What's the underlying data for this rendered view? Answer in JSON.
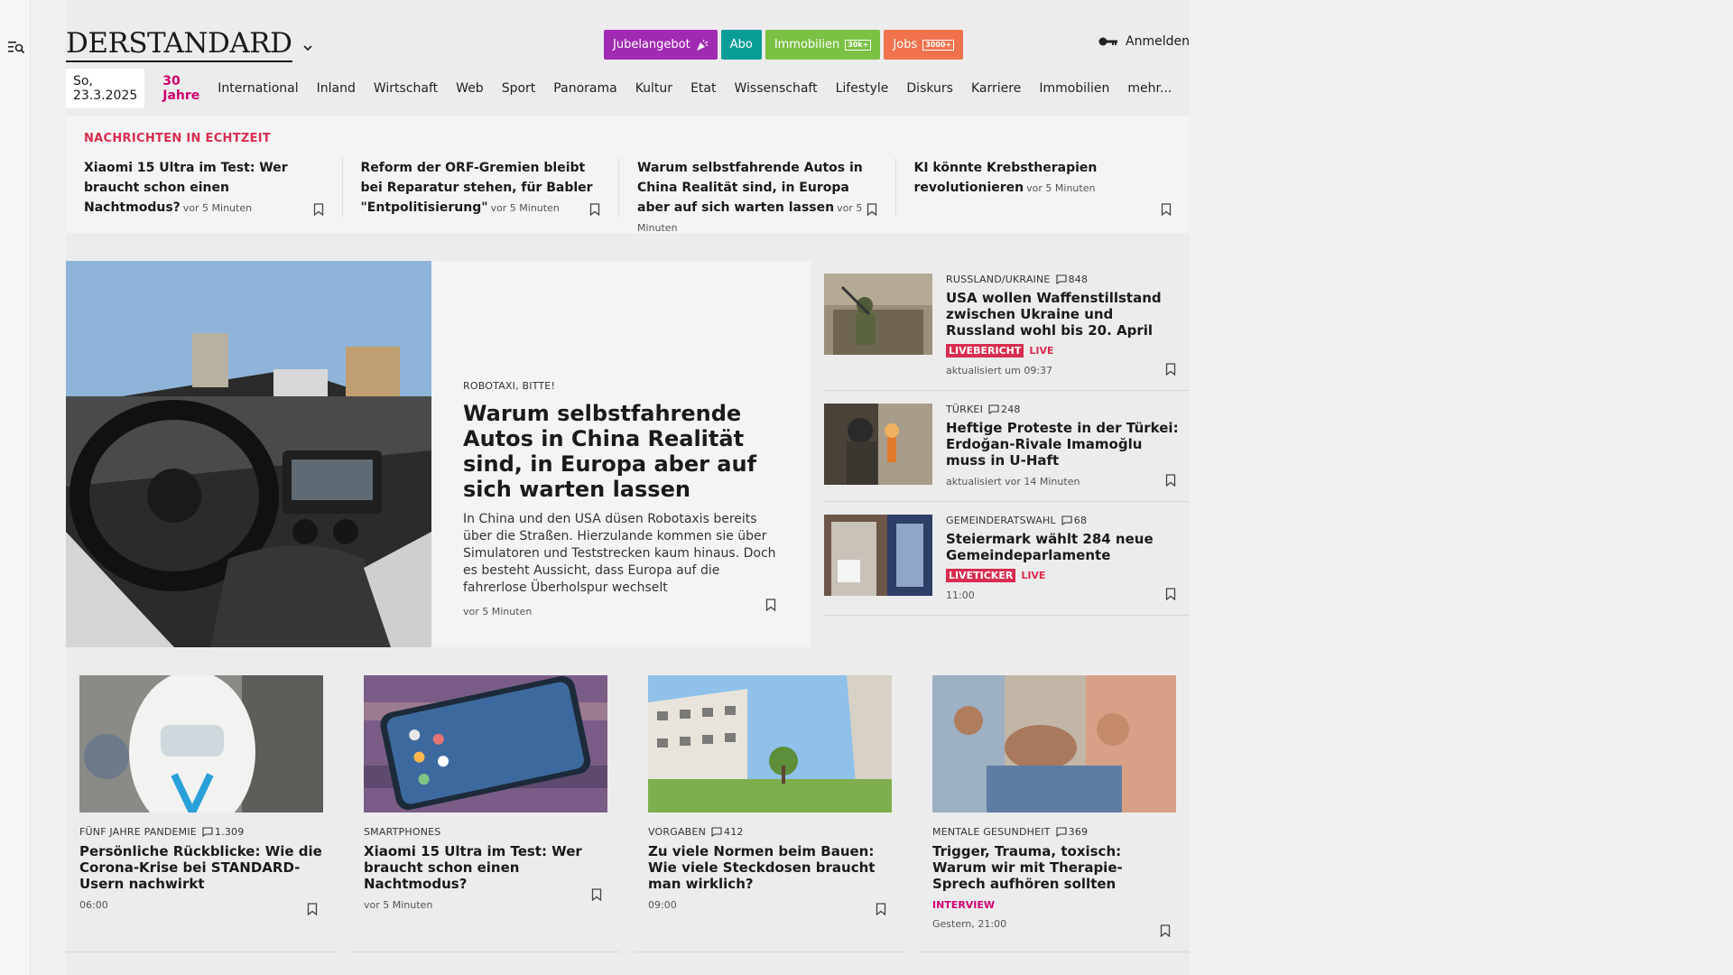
{
  "brand": {
    "logo": "DERSTANDARD"
  },
  "promo": [
    {
      "label": "Jubelangebot",
      "color": "#a12ab3"
    },
    {
      "label": "Abo",
      "color": "#0a9d98"
    },
    {
      "label": "Immobilien",
      "tag": "30k+",
      "color": "#7bc144"
    },
    {
      "label": "Jobs",
      "tag": "3000+",
      "color": "#f0734d"
    }
  ],
  "login": {
    "label": "Anmelden"
  },
  "nav": {
    "date": "So, 23.3.2025",
    "items": [
      "30 Jahre",
      "International",
      "Inland",
      "Wirtschaft",
      "Web",
      "Sport",
      "Panorama",
      "Kultur",
      "Etat",
      "Wissenschaft",
      "Lifestyle",
      "Diskurs",
      "Karriere",
      "Immobilien",
      "mehr..."
    ]
  },
  "ticker": {
    "heading": "NACHRICHTEN IN ECHTZEIT",
    "items": [
      {
        "title": "Xiaomi 15 Ultra im Test: Wer braucht schon einen Nachtmodus?",
        "ago": "vor 5 Minuten"
      },
      {
        "title": "Reform der ORF-Gremien bleibt bei Reparatur stehen, für Babler \"Entpolitisierung\"",
        "ago": "vor 5 Minuten"
      },
      {
        "title": "Warum selbstfahrende Autos in China Realität sind, in Europa aber auf sich warten lassen",
        "ago": "vor 5 Minuten"
      },
      {
        "title": "KI könnte Krebstherapien revolutionieren",
        "ago": "vor 5 Minuten"
      }
    ]
  },
  "hero": {
    "kicker": "ROBOTAXI, BITTE!",
    "title": "Warum selbstfahrende Autos in China Realität sind, in Europa aber auf sich warten lassen",
    "teaser": "In China und den USA düsen Robotaxis bereits über die Straßen. Hierzulande kommen sie über Simulatoren und Teststrecken kaum hinaus. Doch es besteht Aussicht, dass Europa auf die fahrerlose Überholspur wechselt",
    "meta": "vor 5 Minuten"
  },
  "side": [
    {
      "kicker": "RUSSLAND/UKRAINE",
      "comments": "848",
      "title": "USA wollen Waffenstillstand zwischen Ukraine und Russland wohl bis 20. April",
      "badge": "LIVEBERICHT",
      "live": "LIVE",
      "meta": "aktualisiert um 09:37"
    },
    {
      "kicker": "TÜRKEI",
      "comments": "248",
      "title": "Heftige Proteste in der Türkei: Erdoğan-Rivale Imamoğlu muss in U-Haft",
      "meta": "aktualisiert vor 14 Minuten"
    },
    {
      "kicker": "GEMEINDERATSWAHL",
      "comments": "68",
      "title": "Steiermark wählt 284 neue Gemeindeparlamente",
      "badge": "LIVETICKER",
      "live": "LIVE",
      "meta": "11:00"
    }
  ],
  "cards": [
    {
      "kicker": "FÜNF JAHRE PANDEMIE",
      "comments": "1.309",
      "title": "Persönliche Rückblicke: Wie die Corona-Krise bei STANDARD-Usern nachwirkt",
      "meta": "06:00"
    },
    {
      "kicker": "SMARTPHONES",
      "title": "Xiaomi 15 Ultra im Test: Wer braucht schon einen Nachtmodus?",
      "meta": "vor 5 Minuten"
    },
    {
      "kicker": "VORGABEN",
      "comments": "412",
      "title": "Zu viele Normen beim Bauen: Wie viele Steckdosen braucht man wirklich?",
      "meta": "09:00"
    },
    {
      "kicker": "MENTALE GESUNDHEIT",
      "comments": "369",
      "title": "Trigger, Trauma, toxisch: Warum wir mit Therapie-Sprech aufhören sollten",
      "label": "INTERVIEW",
      "meta": "Gestern, 21:00"
    }
  ]
}
